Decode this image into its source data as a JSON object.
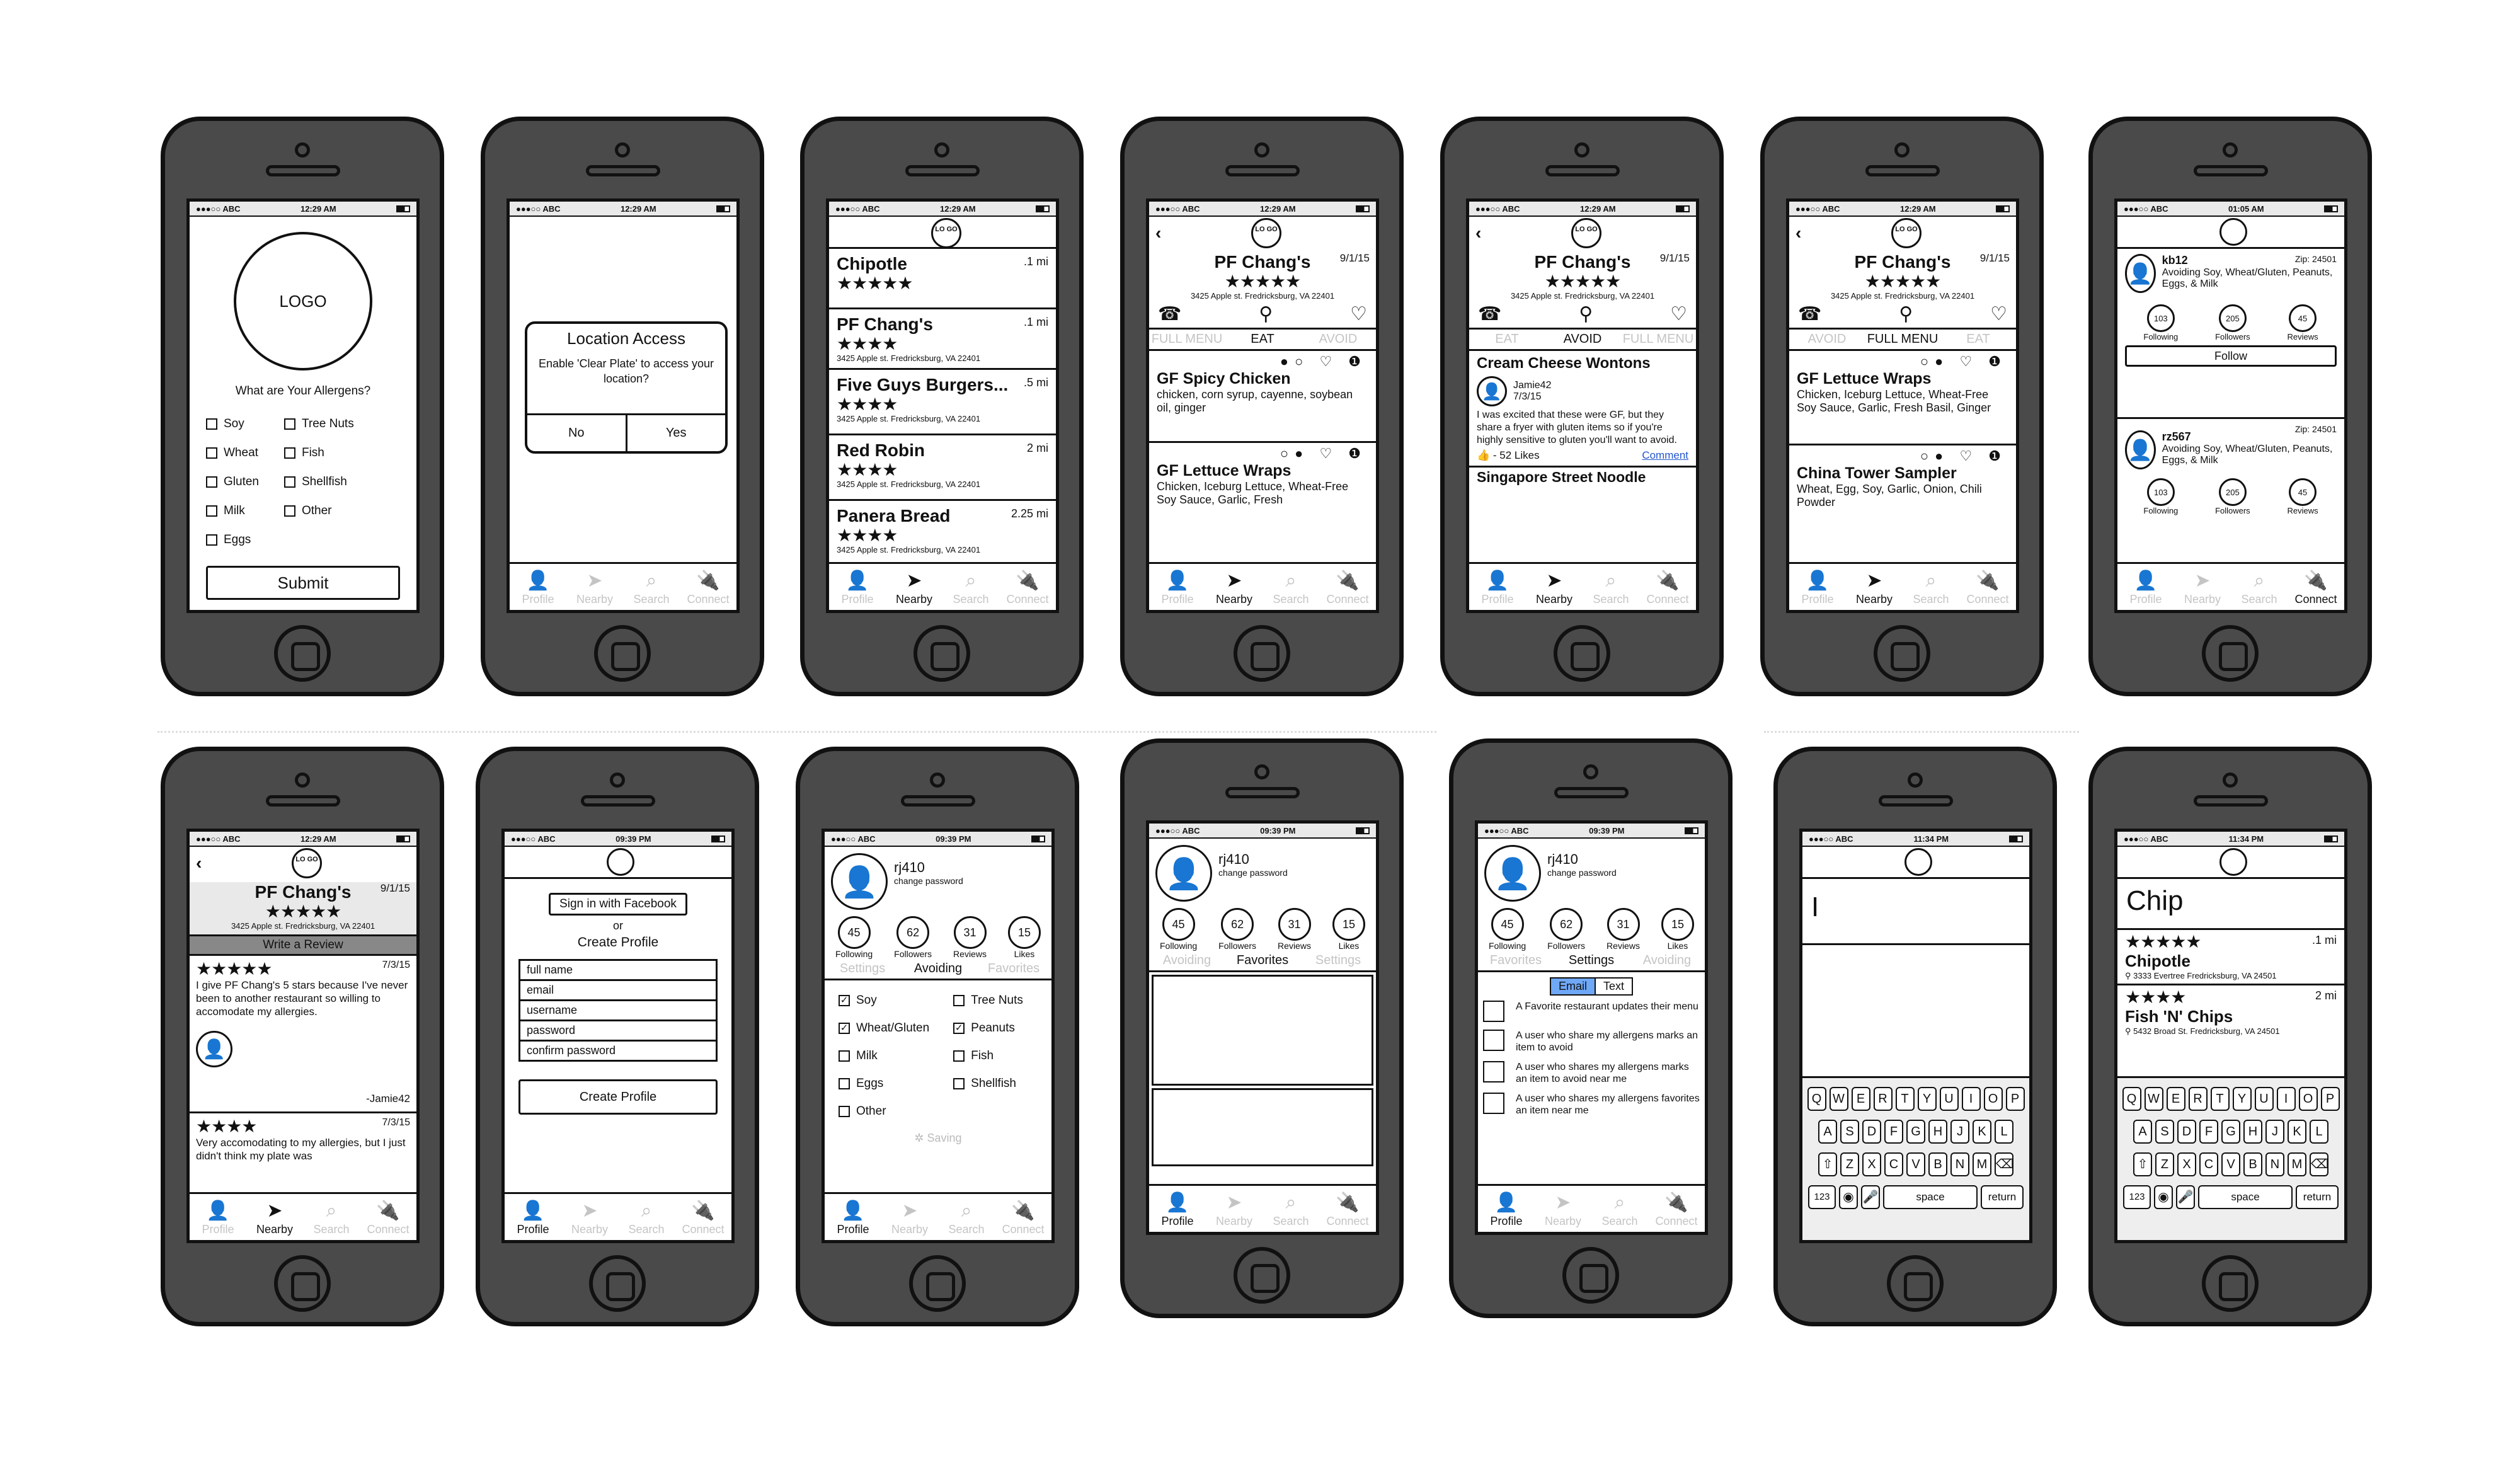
{
  "status": {
    "carrier": "●●●○○ ABC",
    "t1229": "12:29 AM",
    "t0105": "01:05 AM",
    "t0939": "09:39 PM",
    "t1134": "11:34 PM"
  },
  "tabs": {
    "profile": "Profile",
    "nearby": "Nearby",
    "search": "Search",
    "connect": "Connect"
  },
  "logo": {
    "big": "LOGO",
    "small": "LO GO"
  },
  "onboarding": {
    "question": "What are Your Allergens?",
    "left": [
      "Soy",
      "Wheat",
      "Gluten",
      "Milk",
      "Eggs"
    ],
    "right": [
      "Tree Nuts",
      "Fish",
      "Shellfish",
      "Other"
    ],
    "submit": "Submit"
  },
  "location": {
    "title": "Location Access",
    "body": "Enable 'Clear Plate' to access your location?",
    "no": "No",
    "yes": "Yes"
  },
  "nearby": [
    {
      "name": "Chipotle",
      "dist": ".1 mi",
      "stars": "★★★★★",
      "addr": "3425 Apple st. Fredricksburg, VA 22401"
    },
    {
      "name": "PF Chang's",
      "dist": ".1 mi",
      "stars": "★★★★",
      "addr": "3425 Apple st. Fredricksburg, VA 22401"
    },
    {
      "name": "Five Guys Burgers...",
      "dist": ".5 mi",
      "stars": "★★★★",
      "addr": "3425 Apple st. Fredricksburg, VA 22401"
    },
    {
      "name": "Red Robin",
      "dist": "2 mi",
      "stars": "★★★★",
      "addr": "3425 Apple st. Fredricksburg, VA 22401"
    },
    {
      "name": "Panera Bread",
      "dist": "2.25 mi",
      "stars": "★★★★",
      "addr": "3425 Apple st. Fredricksburg, VA 22401"
    }
  ],
  "restaurant": {
    "name": "PF Chang's",
    "date": "9/1/15",
    "stars": "★★★★★",
    "addr": "3425 Apple st. Fredricksburg, VA 22401"
  },
  "rtabs": {
    "full": "FULL MENU",
    "eat": "EAT",
    "avoid": "AVOID"
  },
  "eat": [
    {
      "name": "GF Spicy Chicken",
      "desc": "chicken, corn syrup, cayenne, soybean oil, ginger"
    },
    {
      "name": "GF Lettuce Wraps",
      "desc": "Chicken, Iceburg Lettuce, Wheat-Free Soy Sauce, Garlic, Fresh"
    }
  ],
  "avoidItem": {
    "name": "Cream Cheese Wontons",
    "user": "Jamie42",
    "date": "7/3/15",
    "text": "I was excited that these were GF, but they share a fryer with gluten items so if you're highly sensitive to gluten you'll want to avoid.",
    "likes": "- 52 Likes",
    "comment": "Comment",
    "next": "Singapore Street Noodle"
  },
  "fullmenu": [
    {
      "name": "GF Lettuce Wraps",
      "desc": "Chicken, Iceburg Lettuce, Wheat-Free Soy Sauce, Garlic, Fresh Basil, Ginger"
    },
    {
      "name": "China Tower Sampler",
      "desc": "Wheat, Egg, Soy, Garlic, Onion, Chili Powder"
    }
  ],
  "connect": [
    {
      "user": "kb12",
      "zip": "Zip: 24501",
      "desc": "Avoiding Soy, Wheat/Gluten, Peanuts, Eggs, & Milk",
      "following": "103",
      "followers": "205",
      "reviews": "45",
      "follow": "Follow"
    },
    {
      "user": "rz567",
      "zip": "Zip: 24501",
      "desc": "Avoiding Soy, Wheat/Gluten, Peanuts, Eggs, & Milk",
      "following": "103",
      "followers": "205",
      "reviews": "45"
    }
  ],
  "statLabels": {
    "following": "Following",
    "followers": "Followers",
    "reviews": "Reviews",
    "likes": "Likes"
  },
  "review": {
    "write": "Write a Review",
    "r1stars": "★★★★★",
    "r1date": "7/3/15",
    "r1text": "I give PF Chang's 5 stars because I've never been to another restaurant so willing to accomodate my allergies.",
    "r1user": "-Jamie42",
    "r2stars": "★★★★",
    "r2date": "7/3/15",
    "r2text": "Very accomodating to my allergies, but I just didn't think my plate was"
  },
  "signup": {
    "facebook": "Sign in with Facebook",
    "or": "or",
    "create": "Create Profile",
    "fields": [
      "full name",
      "email",
      "username",
      "password",
      "confirm password"
    ],
    "button": "Create Profile"
  },
  "profile": {
    "user": "rj410",
    "change": "change password",
    "following": "45",
    "followers": "62",
    "reviews": "31",
    "likes": "15"
  },
  "ptabs": {
    "settings": "Settings",
    "avoiding": "Avoiding",
    "favorites": "Favorites"
  },
  "avoiding": {
    "left": [
      {
        "t": "Soy",
        "c": true
      },
      {
        "t": "Wheat/Gluten",
        "c": true
      },
      {
        "t": "Milk",
        "c": false
      },
      {
        "t": "Eggs",
        "c": false
      },
      {
        "t": "Other",
        "c": false
      }
    ],
    "right": [
      {
        "t": "Tree Nuts",
        "c": false
      },
      {
        "t": "Peanuts",
        "c": true
      },
      {
        "t": "Fish",
        "c": false
      },
      {
        "t": "Shellfish",
        "c": false
      }
    ],
    "saving": "Saving"
  },
  "settings": {
    "email": "Email",
    "text": "Text",
    "items": [
      "A Favorite restaurant updates their menu",
      "A user who share my allergens marks an item to avoid",
      "A user who shares my allergens marks an item to avoid near me",
      "A user who shares my allergens favorites an item near me"
    ]
  },
  "search": {
    "caret": "I",
    "query": "Chip",
    "r1stars": "★★★★★",
    "r1name": "Chipotle",
    "r1dist": ".1 mi",
    "r1addr": "3333 Evertree Fredricksburg, VA 24501",
    "r2stars": "★★★★",
    "r2name": "Fish 'N' Chips",
    "r2dist": "2 mi",
    "r2addr": "5432 Broad St. Fredricksburg, VA 24501"
  },
  "keyboard": {
    "row1": [
      "Q",
      "W",
      "E",
      "R",
      "T",
      "Y",
      "U",
      "I",
      "O",
      "P"
    ],
    "row2": [
      "A",
      "S",
      "D",
      "F",
      "G",
      "H",
      "J",
      "K",
      "L"
    ],
    "row3": [
      "Z",
      "X",
      "C",
      "V",
      "B",
      "N",
      "M"
    ],
    "n123": "123",
    "space": "space",
    "ret": "return"
  }
}
